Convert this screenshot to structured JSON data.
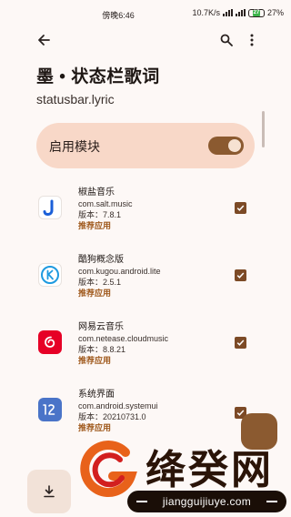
{
  "status": {
    "time": "傍晚6:46",
    "speed": "10.7K/s",
    "battery": "27%",
    "battery_icon_label": "27"
  },
  "appbar": {
    "back_icon": "arrow-back-icon",
    "search_icon": "search-icon",
    "more_icon": "more-vert-icon"
  },
  "page": {
    "title": "墨 • 状态栏歌词",
    "subtitle": "statusbar.lyric"
  },
  "enable": {
    "label": "启用模块",
    "on": true
  },
  "apps": [
    {
      "name": "椒盐音乐",
      "package": "com.salt.music",
      "version": "版本：7.8.1",
      "tag": "推荐应用",
      "checked": true,
      "icon": "salt-music-icon"
    },
    {
      "name": "酷狗概念版",
      "package": "com.kugou.android.lite",
      "version": "版本：2.5.1",
      "tag": "推荐应用",
      "checked": true,
      "icon": "kugou-icon"
    },
    {
      "name": "网易云音乐",
      "package": "com.netease.cloudmusic",
      "version": "版本：8.8.21",
      "tag": "推荐应用",
      "checked": true,
      "icon": "netease-music-icon"
    },
    {
      "name": "系统界面",
      "package": "com.android.systemui",
      "version": "版本：20210731.0",
      "tag": "推荐应用",
      "checked": true,
      "icon": "systemui-icon"
    }
  ],
  "watermark": {
    "text": "绛癸网",
    "url": "jiangguijiuye.com"
  },
  "colors": {
    "background": "#fdf8f6",
    "card": "#f8d8c8",
    "accent": "#8b5a30",
    "recommend": "#a05a1e"
  }
}
